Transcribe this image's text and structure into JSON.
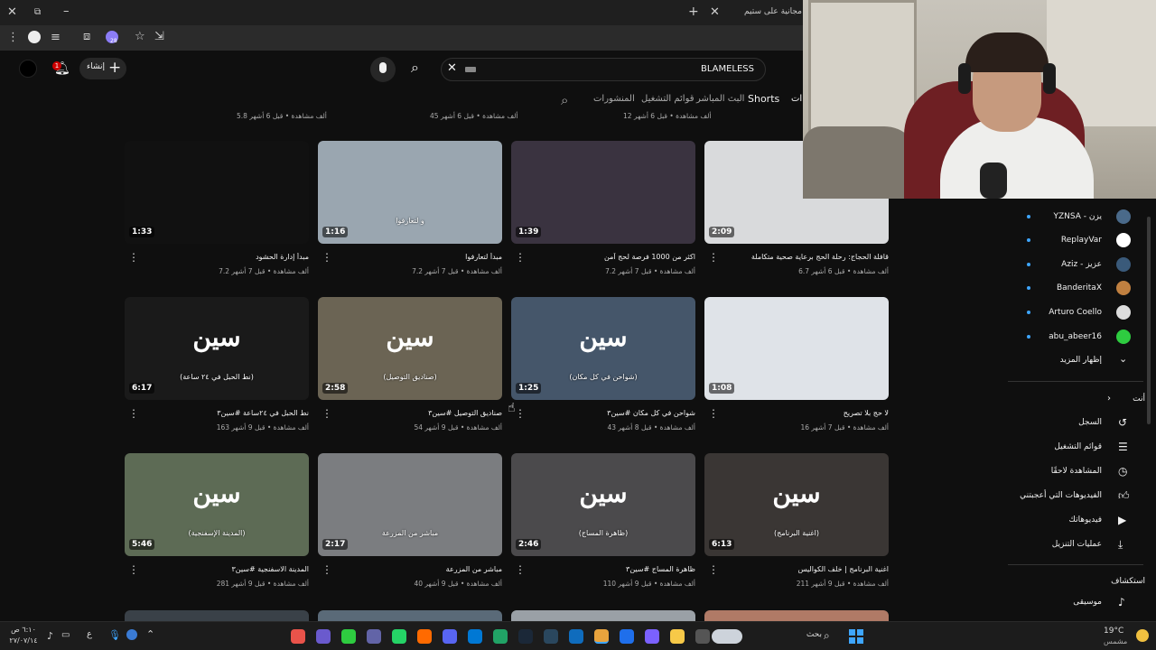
{
  "browser": {
    "tab_title": "مجانية على ستيم",
    "new_tab": "+",
    "close": "✕"
  },
  "header": {
    "create_label": "إنشاء",
    "notif_count": "1",
    "search_value": "BLAMELESS",
    "ext_badge": "28"
  },
  "channel_tabs": [
    "Shorts",
    "البث المباشر",
    "قوائم التشغيل",
    "المنشورات"
  ],
  "channel_tab_cut": "ات",
  "top_metas": [
    "5.8 ألف مشاهدة • قبل 6 أشهر",
    "45 ألف مشاهدة • قبل 6 أشهر",
    "12 ألف مشاهدة • قبل 6 أشهر"
  ],
  "videos": [
    {
      "title": "مبدأ إدارة الحشود",
      "meta": "7.2 ألف مشاهدة • قبل 7 أشهر",
      "duration": "1:33",
      "thumb_text": "",
      "logo": "",
      "bg": "#111111"
    },
    {
      "title": "مبدأ لتعارفوا",
      "meta": "7.2 ألف مشاهدة • قبل 7 أشهر",
      "duration": "1:16",
      "thumb_text": "و لتعارفوا",
      "logo": "",
      "bg": "#9aa6b0"
    },
    {
      "title": "اكثر من 1000 فرصة لحج آمن",
      "meta": "7.2 ألف مشاهدة • قبل 7 أشهر",
      "duration": "1:39",
      "thumb_text": "",
      "logo": "",
      "bg": "#3a3340"
    },
    {
      "title": "قافلة الحجاج: رحلة الحج برعاية صحية متكاملة",
      "meta": "6.7 ألف مشاهدة • قبل 6 أشهر",
      "duration": "2:09",
      "thumb_text": "",
      "logo": "",
      "bg": "#d9dadc"
    },
    {
      "title": "نط الحبل في ٢٤ساعة #سين٣",
      "meta": "163 ألف مشاهدة • قبل 9 أشهر",
      "duration": "6:17",
      "thumb_text": "(نط الحبل في ٢٤ ساعة)",
      "logo": "سين",
      "bg": "#1a1a1a"
    },
    {
      "title": "صناديق التوصيل #سين٣",
      "meta": "54 ألف مشاهدة • قبل 9 أشهر",
      "duration": "2:58",
      "thumb_text": "(صناديق التوصيل)",
      "logo": "سين",
      "bg": "#6b6454"
    },
    {
      "title": "شواحن في كل مكان #سين٣",
      "meta": "43 ألف مشاهدة • قبل 8 أشهر",
      "duration": "1:25",
      "thumb_text": "(شواحن في كل مكان)",
      "logo": "سين",
      "bg": "#45566a"
    },
    {
      "title": "لا حج بلا تصريح",
      "meta": "16 ألف مشاهدة • قبل 7 أشهر",
      "duration": "1:08",
      "thumb_text": "",
      "logo": "",
      "bg": "#dfe3e8"
    },
    {
      "title": "المدينة الاسفنجية #سين٣",
      "meta": "281 ألف مشاهدة • قبل 9 أشهر",
      "duration": "5:46",
      "thumb_text": "(المدينة الإسفنجية)",
      "logo": "سين",
      "bg": "#5d6b55"
    },
    {
      "title": "مباشر من المزرعة",
      "meta": "40 ألف مشاهدة • قبل 9 أشهر",
      "duration": "2:17",
      "thumb_text": "مباشر من المزرعة",
      "logo": "",
      "bg": "#7b7d80"
    },
    {
      "title": "ظاهرة المساج #سين٣",
      "meta": "110 ألف مشاهدة • قبل 9 أشهر",
      "duration": "2:46",
      "thumb_text": "(ظاهرة المساج)",
      "logo": "سين",
      "bg": "#4b4a4c"
    },
    {
      "title": "اغنية البرنامج | خلف الكواليس",
      "meta": "211 ألف مشاهدة • قبل 9 أشهر",
      "duration": "6:13",
      "thumb_text": "(اغنية البرنامج)",
      "logo": "سين",
      "bg": "#3a3634"
    }
  ],
  "sidebar": {
    "subs": [
      {
        "name": "YZNSA - يزن",
        "color": "#4a6a8a"
      },
      {
        "name": "ReplayVar",
        "color": "#ffffff"
      },
      {
        "name": "Aziz - عزيز",
        "color": "#3a5a7a"
      },
      {
        "name": "BanderitaX",
        "color": "#c08040"
      },
      {
        "name": "Arturo Coello",
        "color": "#dddddd"
      },
      {
        "name": "abu_abeer16",
        "color": "#2ecc40"
      }
    ],
    "show_more": "إظهار المزيد",
    "you_heading": "أنت",
    "you_items": [
      "السجل",
      "قوائم التشغيل",
      "المشاهدة لاحقًا",
      "الفيديوهات التي أعجبتني",
      "فيديوهاتك",
      "عمليات التنزيل"
    ],
    "explore_heading": "استكشاف",
    "explore_items": [
      "موسيقى"
    ]
  },
  "taskbar": {
    "search_label": "بحث",
    "weather_temp": "19°C",
    "weather_desc": "مشمس",
    "lang": "ع",
    "time": "٦:١٠ ص",
    "date": "٢٧/٠٧/١٤"
  },
  "colors": {
    "accent_blue": "#3ea6ff",
    "notif_red": "#cc0000",
    "bg": "#0f0f0f"
  }
}
